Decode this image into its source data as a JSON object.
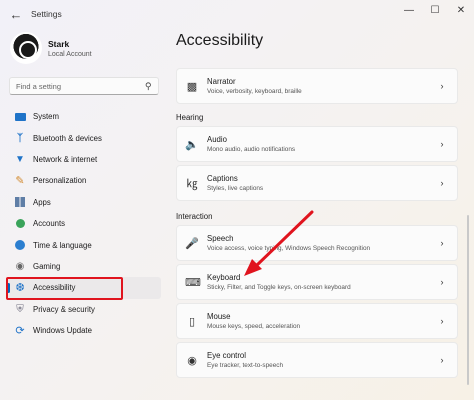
{
  "window": {
    "title": "Settings",
    "back_icon": "arrow-left-icon"
  },
  "account": {
    "name": "Stark",
    "type": "Local Account"
  },
  "search": {
    "placeholder": "Find a setting"
  },
  "sidebar": {
    "items": [
      {
        "label": "System",
        "icon": "monitor-icon"
      },
      {
        "label": "Bluetooth & devices",
        "icon": "bluetooth-icon"
      },
      {
        "label": "Network & internet",
        "icon": "wifi-icon"
      },
      {
        "label": "Personalization",
        "icon": "brush-icon"
      },
      {
        "label": "Apps",
        "icon": "apps-icon"
      },
      {
        "label": "Accounts",
        "icon": "person-icon"
      },
      {
        "label": "Time & language",
        "icon": "globe-clock-icon"
      },
      {
        "label": "Gaming",
        "icon": "gamepad-icon"
      },
      {
        "label": "Accessibility",
        "icon": "accessibility-icon",
        "selected": true
      },
      {
        "label": "Privacy & security",
        "icon": "shield-icon"
      },
      {
        "label": "Windows Update",
        "icon": "update-icon"
      }
    ],
    "highlight_color": "#e0141e"
  },
  "main": {
    "title": "Accessibility",
    "narrator": {
      "title": "Narrator",
      "desc": "Voice, verbosity, keyboard, braille"
    },
    "hearing_label": "Hearing",
    "audio": {
      "title": "Audio",
      "desc": "Mono audio, audio notifications"
    },
    "captions": {
      "title": "Captions",
      "desc": "Styles, live captions"
    },
    "interaction_label": "Interaction",
    "speech": {
      "title": "Speech",
      "desc": "Voice access, voice typing, Windows Speech Recognition"
    },
    "keyboard": {
      "title": "Keyboard",
      "desc": "Sticky, Filter, and Toggle keys, on-screen keyboard"
    },
    "mouse": {
      "title": "Mouse",
      "desc": "Mouse keys, speed, acceleration"
    },
    "eye_control": {
      "title": "Eye control",
      "desc": "Eye tracker, text-to-speech"
    }
  },
  "accent_color": "#0067c0",
  "annotation_arrow_color": "#e0141e"
}
